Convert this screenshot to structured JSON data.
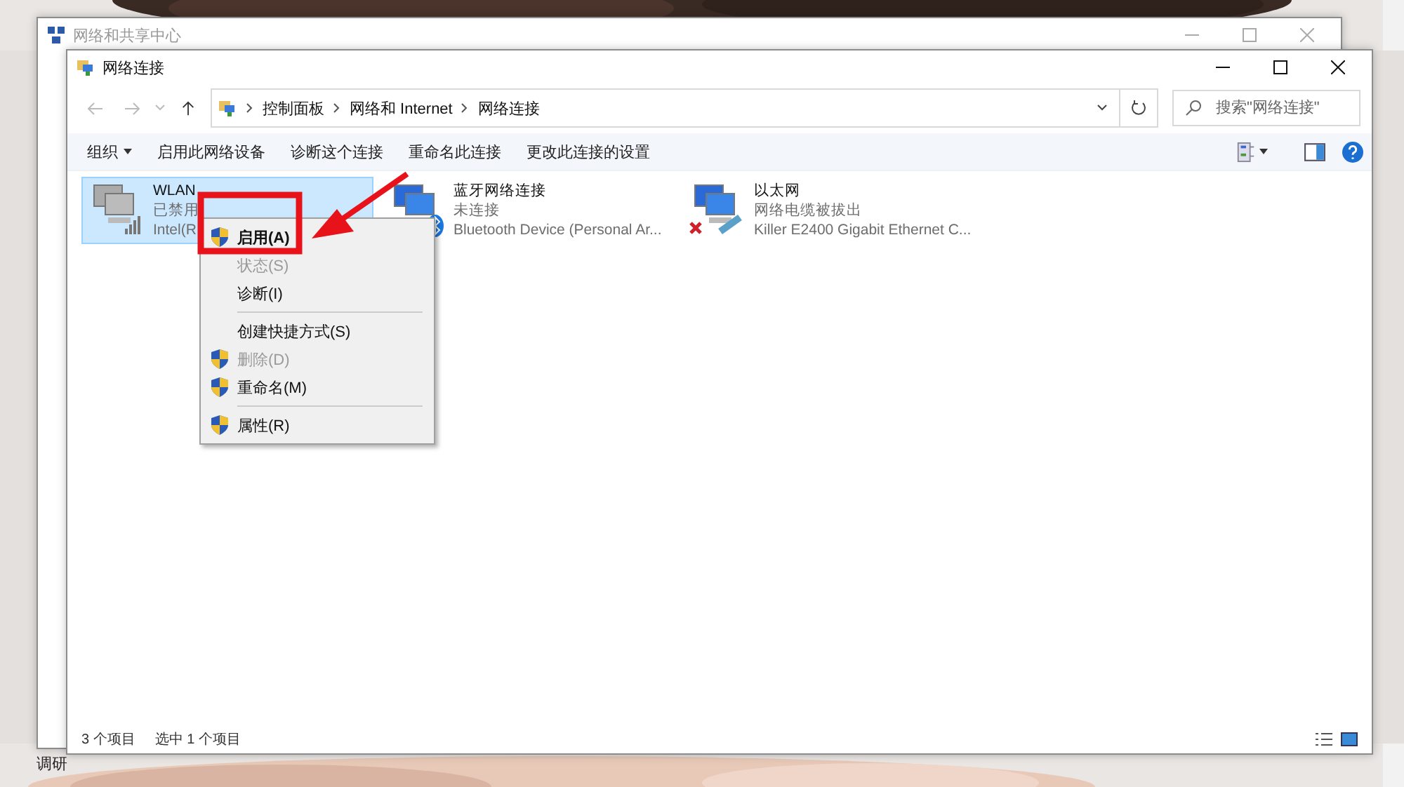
{
  "back_window": {
    "title": "网络和共享中心"
  },
  "desktop_icons": [
    {
      "label": "调研"
    }
  ],
  "window": {
    "title": "网络连接"
  },
  "breadcrumb": [
    "控制面板",
    "网络和 Internet",
    "网络连接"
  ],
  "search": {
    "placeholder": "搜索\"网络连接\""
  },
  "commands": [
    {
      "label": "组织",
      "kind": "dropdown"
    },
    {
      "label": "启用此网络设备",
      "kind": "plain"
    },
    {
      "label": "诊断这个连接",
      "kind": "plain"
    },
    {
      "label": "重命名此连接",
      "kind": "plain"
    },
    {
      "label": "更改此连接的设置",
      "kind": "plain"
    }
  ],
  "connections": [
    {
      "name": "WLAN",
      "status": "已禁用",
      "device": "Intel(R",
      "kind": "wifi",
      "selected": true
    },
    {
      "name": "蓝牙网络连接",
      "status": "未连接",
      "device": "Bluetooth Device (Personal Ar...",
      "kind": "bluetooth",
      "selected": false
    },
    {
      "name": "以太网",
      "status": "网络电缆被拔出",
      "device": "Killer E2400 Gigabit Ethernet C...",
      "kind": "ethernet",
      "selected": false
    }
  ],
  "context_menu": [
    {
      "kind": "item",
      "label": "启用(A)",
      "shield": true,
      "default": true,
      "disabled": false
    },
    {
      "kind": "item",
      "label": "状态(S)",
      "shield": false,
      "default": false,
      "disabled": true
    },
    {
      "kind": "item",
      "label": "诊断(I)",
      "shield": false,
      "default": false,
      "disabled": false
    },
    {
      "kind": "separator"
    },
    {
      "kind": "item",
      "label": "创建快捷方式(S)",
      "shield": false,
      "default": false,
      "disabled": false
    },
    {
      "kind": "item",
      "label": "删除(D)",
      "shield": true,
      "default": false,
      "disabled": true
    },
    {
      "kind": "item",
      "label": "重命名(M)",
      "shield": true,
      "default": false,
      "disabled": false
    },
    {
      "kind": "separator"
    },
    {
      "kind": "item",
      "label": "属性(R)",
      "shield": true,
      "default": false,
      "disabled": false
    }
  ],
  "status_bar": [
    "3 个项目",
    "选中 1 个项目"
  ]
}
